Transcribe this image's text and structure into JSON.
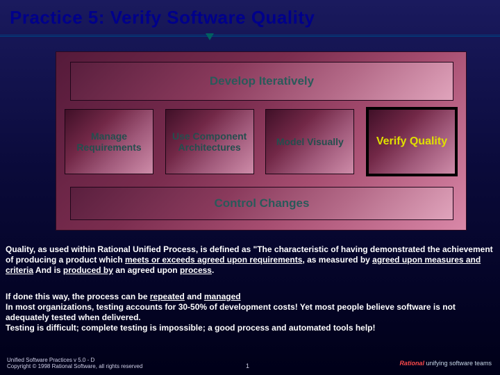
{
  "title": "Practice 5: Verify Software Quality",
  "diagram": {
    "top": "Develop Iteratively",
    "boxes": [
      {
        "label": "Manage Requirements"
      },
      {
        "label": "Use Component Architectures"
      },
      {
        "label": "Model Visually"
      },
      {
        "label": "Verify Quality",
        "highlight": true
      }
    ],
    "bottom": "Control Changes"
  },
  "para1": {
    "lead": "Quality, as used within Rational Unified Process, is defined as \"The characteristic of having demonstrated the achievement of producing a product which ",
    "u1": "meets or exceeds agreed upon requirements",
    "mid1": ", as measured by ",
    "u2": "agreed upon measures and criteria",
    "mid2": " And is ",
    "u3": "produced by",
    "mid3": " an agreed upon ",
    "u4": "process",
    "tail": "."
  },
  "para2": {
    "l1a": "If done this way, the process can be ",
    "l1u1": "repeated",
    "l1b": " and ",
    "l1u2": "managed",
    "l2": "In most organizations, testing accounts for 30-50% of development costs!  Yet most people believe software is not adequately tested when delivered.",
    "l3": "Testing is difficult;  complete testing is impossible;  a good process and automated tools help!"
  },
  "footer": {
    "line1": "Unified Software Practices v 5.0 - D",
    "line2": "Copyright © 1998 Rational Software, all rights reserved"
  },
  "page": "1",
  "brand": {
    "a": "Rational",
    "b": " unifying software teams"
  }
}
